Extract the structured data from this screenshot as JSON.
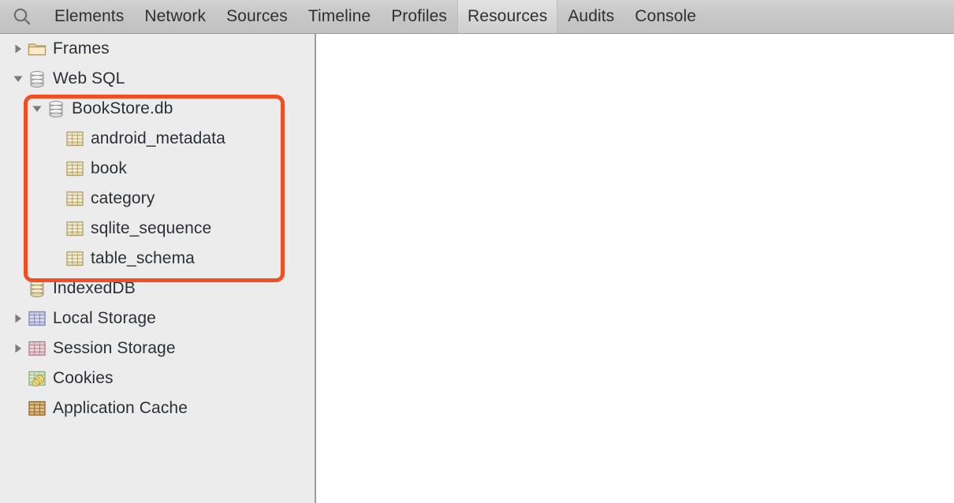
{
  "toolbar": {
    "search_icon": "search-icon",
    "tabs": [
      {
        "label": "Elements",
        "selected": false
      },
      {
        "label": "Network",
        "selected": false
      },
      {
        "label": "Sources",
        "selected": false
      },
      {
        "label": "Timeline",
        "selected": false
      },
      {
        "label": "Profiles",
        "selected": false
      },
      {
        "label": "Resources",
        "selected": true
      },
      {
        "label": "Audits",
        "selected": false
      },
      {
        "label": "Console",
        "selected": false
      }
    ]
  },
  "sidebar": {
    "rows": [
      {
        "label": "Frames",
        "icon": "folder-icon",
        "twisty": "collapsed",
        "level": 1
      },
      {
        "label": "Web SQL",
        "icon": "database-icon",
        "twisty": "expanded",
        "level": 1
      },
      {
        "label": "BookStore.db",
        "icon": "database-icon",
        "twisty": "expanded",
        "level": 2
      },
      {
        "label": "android_metadata",
        "icon": "table-icon",
        "twisty": "none",
        "level": 3
      },
      {
        "label": "book",
        "icon": "table-icon",
        "twisty": "none",
        "level": 3
      },
      {
        "label": "category",
        "icon": "table-icon",
        "twisty": "none",
        "level": 3
      },
      {
        "label": "sqlite_sequence",
        "icon": "table-icon",
        "twisty": "none",
        "level": 3
      },
      {
        "label": "table_schema",
        "icon": "table-icon",
        "twisty": "none",
        "level": 3
      },
      {
        "label": "IndexedDB",
        "icon": "indexeddb-icon",
        "twisty": "none",
        "level": 1
      },
      {
        "label": "Local Storage",
        "icon": "local-storage-icon",
        "twisty": "collapsed",
        "level": 1
      },
      {
        "label": "Session Storage",
        "icon": "session-storage-icon",
        "twisty": "collapsed",
        "level": 1
      },
      {
        "label": "Cookies",
        "icon": "cookies-icon",
        "twisty": "none",
        "level": 1
      },
      {
        "label": "Application Cache",
        "icon": "app-cache-icon",
        "twisty": "none",
        "level": 1
      }
    ]
  },
  "annotation": {
    "type": "highlight-rectangle",
    "color": "#ef4f22",
    "covers": [
      "BookStore.db",
      "android_metadata",
      "book",
      "category",
      "sqlite_sequence",
      "table_schema"
    ]
  },
  "colors": {
    "toolbar_bg": "#c6c6c6",
    "sidebar_bg": "#ececec",
    "content_bg": "#ffffff",
    "text": "#2b3038",
    "highlight": "#ef4f22",
    "divider": "#9c9c9c"
  }
}
